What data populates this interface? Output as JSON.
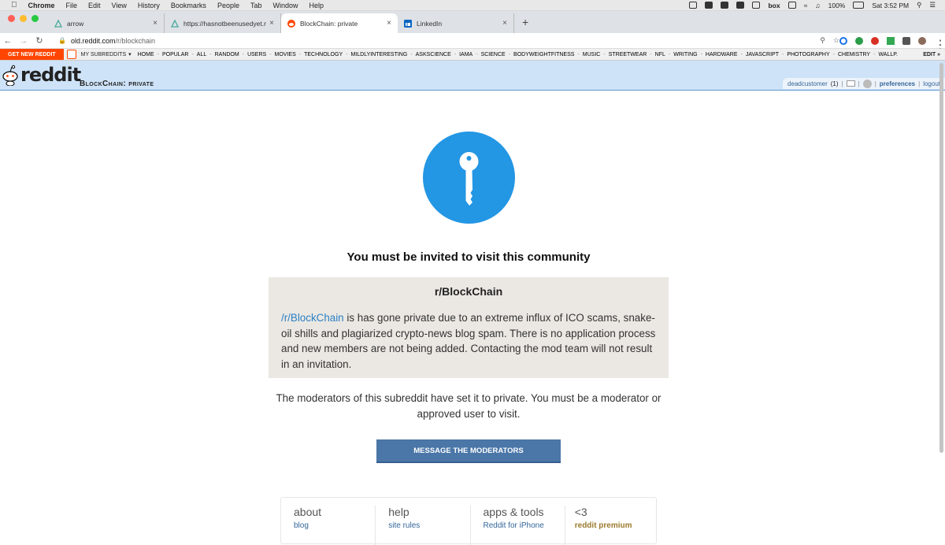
{
  "menubar": {
    "app": "Chrome",
    "items": [
      "File",
      "Edit",
      "View",
      "History",
      "Bookmarks",
      "People",
      "Tab",
      "Window",
      "Help"
    ],
    "battery": "100%",
    "clock": "Sat 3:52 PM",
    "box_label": "box"
  },
  "tabs": [
    {
      "title": "arrow",
      "close": "×"
    },
    {
      "title": "https://hasnotbeenusedyet.net",
      "close": "×"
    },
    {
      "title": "BlockChain: private",
      "close": "×"
    },
    {
      "title": "LinkedIn",
      "close": "×"
    }
  ],
  "new_tab": "+",
  "address": {
    "domain": "old.reddit.com",
    "path": "/r/blockchain"
  },
  "srbar": {
    "get_new": "GET NEW REDDIT",
    "my_subreddits": "MY SUBREDDITS",
    "links": [
      "HOME",
      "POPULAR",
      "ALL",
      "RANDOM",
      "USERS",
      "MOVIES",
      "TECHNOLOGY",
      "MILDLYINTERESTING",
      "ASKSCIENCE",
      "IAMA",
      "SCIENCE",
      "BODYWEIGHTFITNESS",
      "MUSIC",
      "STREETWEAR",
      "NFL",
      "WRITING",
      "HARDWARE",
      "JAVASCRIPT",
      "PHOTOGRAPHY",
      "CHEMISTRY",
      "WALLP."
    ],
    "edit": "EDIT »"
  },
  "header": {
    "logo_text": "reddit",
    "page_name": "BlockChain: private",
    "user": "deadcustomer",
    "karma": "(1)",
    "preferences": "preferences",
    "logout": "logout"
  },
  "main": {
    "title": "You must be invited to visit this community",
    "subreddit": "r/BlockChain",
    "desc_link": "/r/BlockChain",
    "desc_text": " is has gone private due to an extreme influx of ICO scams, snake-oil shills and plagiarized crypto-news blog spam. There is no application process and new members are not being added. Contacting the mod team will not result in an invitation.",
    "mod_note": "The moderators of this subreddit have set it to private. You must be a moderator or approved user to visit.",
    "button": "MESSAGE THE MODERATORS"
  },
  "footer": [
    {
      "heading": "about",
      "link": "blog"
    },
    {
      "heading": "help",
      "link": "site rules"
    },
    {
      "heading": "apps & tools",
      "link": "Reddit for iPhone"
    },
    {
      "heading": "<3",
      "link": "reddit premium"
    }
  ],
  "colors": {
    "reddit_orange": "#ff4500",
    "header_blue": "#cee3f8",
    "key_blue": "#2396e4",
    "button_blue": "#4a76a8",
    "box_beige": "#ebe8e3"
  }
}
